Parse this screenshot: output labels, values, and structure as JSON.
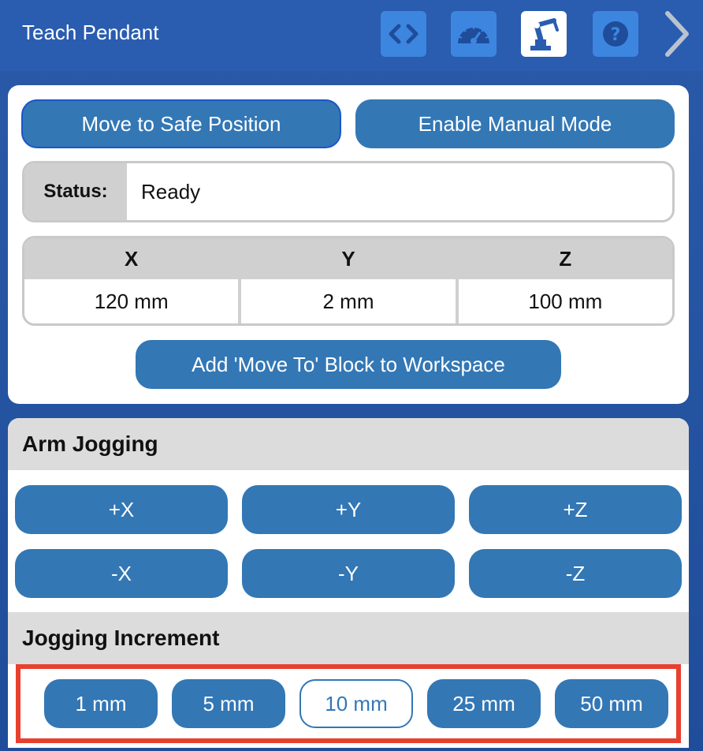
{
  "header": {
    "title": "Teach Pendant",
    "buttons": [
      {
        "icon": "code-icon"
      },
      {
        "icon": "speedometer-icon"
      },
      {
        "icon": "robot-arm-icon",
        "active": true
      },
      {
        "icon": "help-icon"
      }
    ],
    "next_icon": "chevron-right-icon"
  },
  "top_panel": {
    "move_safe_label": "Move to Safe Position",
    "manual_mode_label": "Enable Manual Mode",
    "status_label": "Status:",
    "status_value": "Ready",
    "coords": {
      "headers": [
        "X",
        "Y",
        "Z"
      ],
      "values": [
        "120 mm",
        "2 mm",
        "100 mm"
      ]
    },
    "add_block_label": "Add 'Move To' Block to Workspace"
  },
  "arm_jogging": {
    "title": "Arm Jogging",
    "buttons": [
      "+X",
      "+Y",
      "+Z",
      "-X",
      "-Y",
      "-Z"
    ]
  },
  "jogging_increment": {
    "title": "Jogging Increment",
    "options": [
      "1 mm",
      "5 mm",
      "10 mm",
      "25 mm",
      "50 mm"
    ],
    "selected": "10 mm"
  },
  "colors": {
    "header_bg": "#2a5cb0",
    "button_blue": "#3377b5",
    "highlight_red": "#e8402f"
  }
}
